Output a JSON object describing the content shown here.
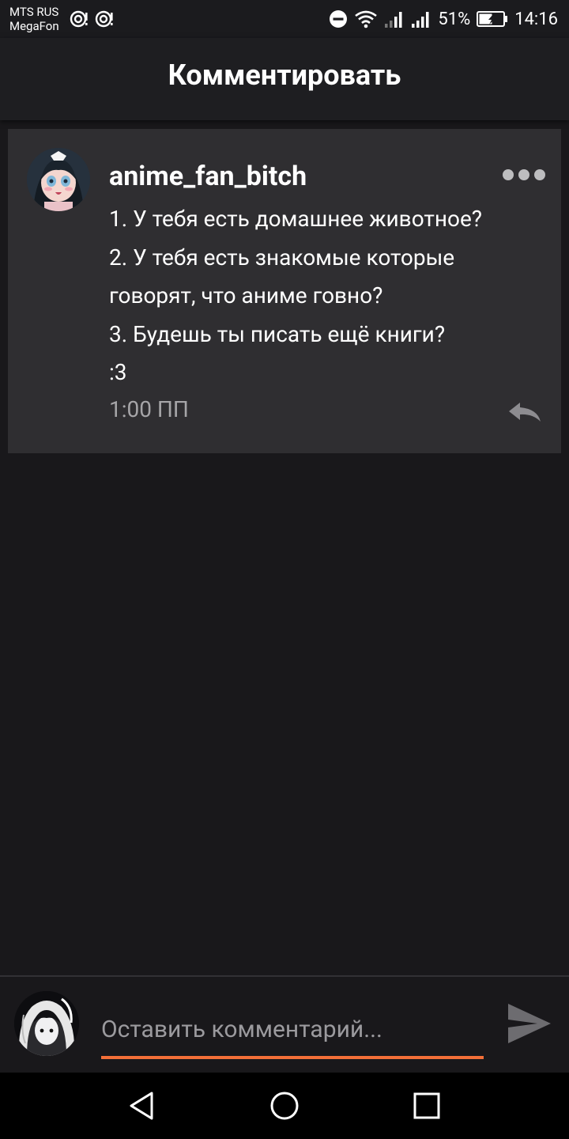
{
  "status_bar": {
    "carrier_line1": "MTS RUS",
    "carrier_line2": "MegaFon",
    "left_icons": [
      "notification-icon",
      "notification-icon"
    ],
    "right_icons": [
      "do-not-disturb-icon",
      "wifi-icon",
      "signal-icon",
      "signal-icon",
      "battery-icon"
    ],
    "battery": "51%",
    "time": "14:16"
  },
  "header": {
    "title": "Комментировать"
  },
  "comment": {
    "author": "anime_fan_bitch",
    "lines": [
      "1. У тебя есть домашнее животное?",
      "2. У тебя есть знакомые которые",
      "говорят, что аниме говно?",
      "3. Будешь ты писать ещё книги?",
      ":3"
    ],
    "time": "1:00 ПП",
    "icons": {
      "more": "more-dots-icon",
      "reply": "reply-arrow-icon"
    }
  },
  "input_bar": {
    "placeholder": "Оставить комментарий...",
    "value": "",
    "send_icon": "send-icon",
    "accent_color": "#f36f38"
  },
  "nav_bar": {
    "icons": [
      "back-icon",
      "home-icon",
      "recents-icon"
    ]
  },
  "colors": {
    "background": "#19181b",
    "card": "#2f2e31",
    "header": "#1e1e21",
    "muted_text": "#a6a5a8",
    "accent": "#f36f38"
  }
}
